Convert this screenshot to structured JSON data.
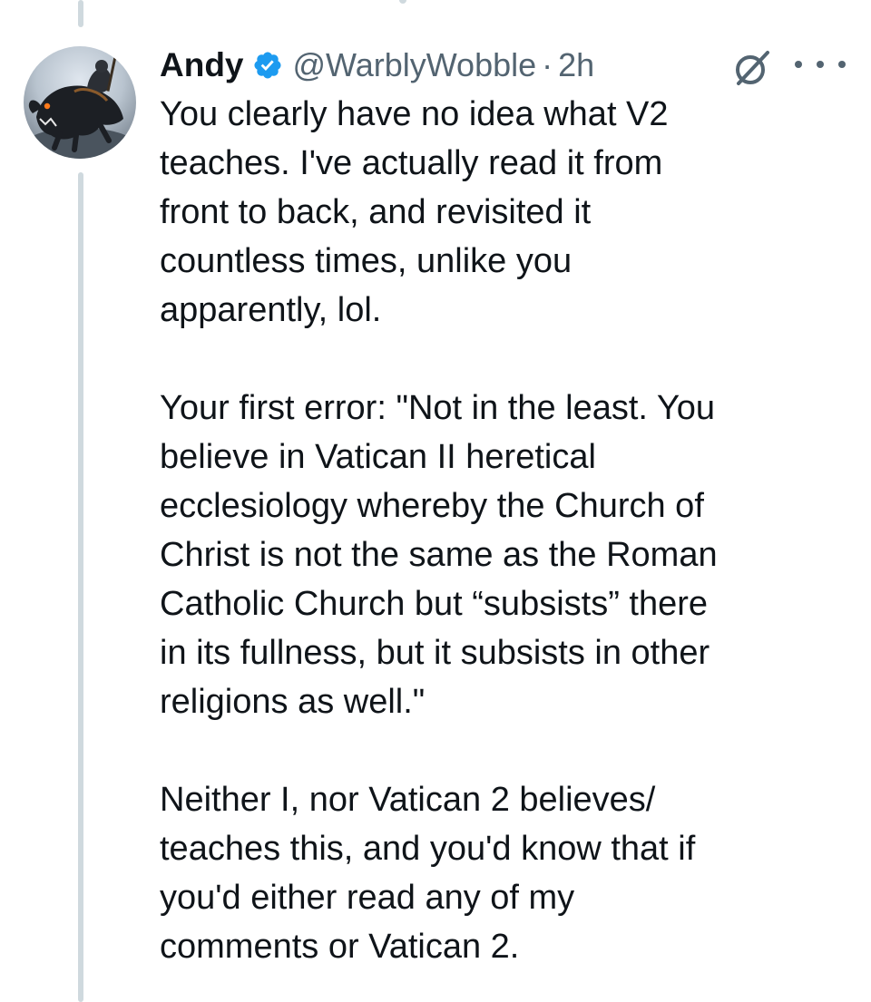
{
  "tweet": {
    "author_name": "Andy",
    "handle": "@WarblyWobble",
    "separator": "·",
    "timestamp": "2h",
    "paragraphs": [
      "You clearly have no idea what V2\nteaches. I've actually read it from\nfront to back, and revisited it\ncountless times, unlike you\napparently, lol.",
      "Your first error: \"Not in the least. You\nbelieve in Vatican II heretical\necclesiology whereby the Church of\nChrist is not the same as the Roman\nCatholic Church but “subsists” there\nin its fullness, but it subsists in other\nreligions as well.\"",
      "Neither I, nor Vatican 2 believes/\nteaches this, and you'd know that if\nyou'd either read any of my\ncomments or Vatican 2."
    ]
  },
  "icons": {
    "verified": "verified-badge-icon",
    "grok": "grok-icon",
    "more": "more-options-icon"
  },
  "colors": {
    "verified_blue": "#1d9bf0",
    "text_primary": "#0f1419",
    "text_secondary": "#536471",
    "thread_line": "#cfd9de"
  }
}
